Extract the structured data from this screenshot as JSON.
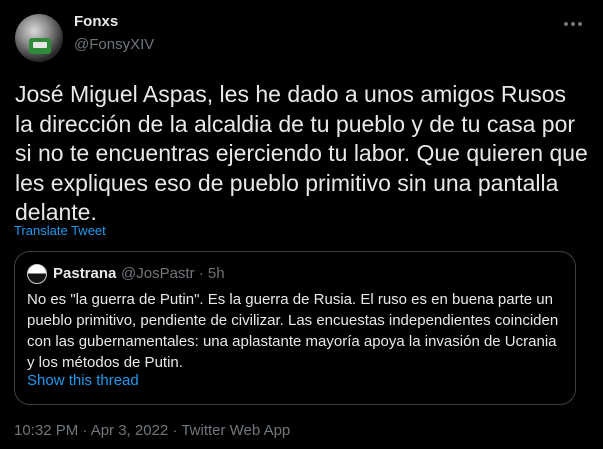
{
  "author": {
    "display_name": "Fonxs",
    "handle": "@FonsyXIV"
  },
  "tweet": {
    "text": "José Miguel Aspas, les he dado a unos amigos Rusos la dirección de la alcaldia de tu pueblo y de tu casa por si no te encuentras ejerciendo tu labor. Que quieren que les expliques eso de pueblo primitivo sin una pantalla delante.",
    "translate_label": "Translate Tweet",
    "timestamp": "10:32 PM · Apr 3, 2022 · Twitter Web App"
  },
  "quote": {
    "display_name": "Pastrana",
    "handle_time": "@JosPastr · 5h",
    "text": "No es \"la guerra de Putin\". Es la guerra de Rusia. El ruso es en buena parte un pueblo primitivo, pendiente de civilizar. Las encuestas independientes coinciden con las gubernamentales: una aplastante mayoría apoya la invasión de Ucrania y los métodos de Putin.",
    "show_thread_label": "Show this thread"
  },
  "icons": {
    "more": "more-options-icon"
  },
  "colors": {
    "background": "#000000",
    "text": "#e7e9ea",
    "secondary": "#71767b",
    "link": "#1d9bf0",
    "border": "#3e4144"
  }
}
